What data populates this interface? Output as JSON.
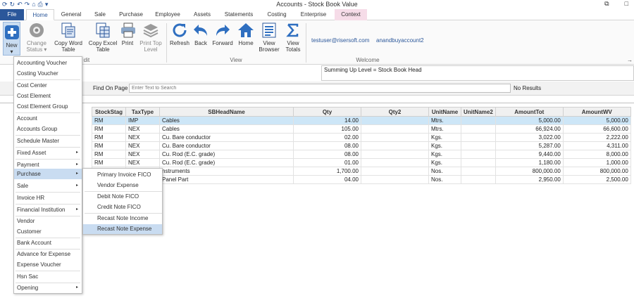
{
  "window": {
    "title": "Accounts - Stock Book Value"
  },
  "quick_access": [
    "qat-refresh-icon",
    "qat-sync-icon",
    "qat-undo-icon",
    "qat-redo-icon",
    "qat-home-icon",
    "qat-print-icon",
    "qat-dropdown-icon"
  ],
  "tabs": [
    {
      "label": "File"
    },
    {
      "label": "Home"
    },
    {
      "label": "General"
    },
    {
      "label": "Sale"
    },
    {
      "label": "Purchase"
    },
    {
      "label": "Employee"
    },
    {
      "label": "Assets"
    },
    {
      "label": "Statements"
    },
    {
      "label": "Costing"
    },
    {
      "label": "Enterprise"
    },
    {
      "label": "Context"
    }
  ],
  "ribbon": {
    "new": {
      "label": "New",
      "caret": "▾"
    },
    "change_status": {
      "line1": "Change",
      "line2": "Status ▾"
    },
    "copy_word": {
      "line1": "Copy Word",
      "line2": "Table"
    },
    "copy_excel": {
      "line1": "Copy Excel",
      "line2": "Table"
    },
    "print": {
      "label": "Print"
    },
    "print_top": {
      "line1": "Print Top",
      "line2": "Level"
    },
    "refresh": {
      "label": "Refresh"
    },
    "back": {
      "label": "Back"
    },
    "forward": {
      "label": "Forward"
    },
    "home": {
      "label": "Home"
    },
    "view_browser": {
      "line1": "View",
      "line2": "Browser"
    },
    "view_totals": {
      "line1": "View",
      "line2": "Totals"
    },
    "edit_group_fragment": "dit",
    "view_group": "View",
    "welcome_group": "Welcome",
    "user_email": "testuser@risersoft.com",
    "account_name": "anandbuyaccount2",
    "pin": "→"
  },
  "summary": {
    "text": "Summing Up Level = Stock Book Head"
  },
  "find": {
    "label": "Find On Page",
    "placeholder": "Enter Text to Search",
    "result": "No Results"
  },
  "grid": {
    "columns": [
      "StockStag",
      "TaxType",
      "SBHeadName",
      "Qty",
      "Qty2",
      "UnitName",
      "UnitName2",
      "AmountTot",
      "AmountWV"
    ],
    "rows": [
      [
        "RM",
        "IMP",
        "Cables",
        "14.00",
        "",
        "Mtrs.",
        "",
        "5,000.00",
        "5,000.00"
      ],
      [
        "RM",
        "NEX",
        "Cables",
        "105.00",
        "",
        "Mtrs.",
        "",
        "66,924.00",
        "66,600.00"
      ],
      [
        "RM",
        "NEX",
        "Cu. Bare conductor",
        "02.00",
        "",
        "Kgs.",
        "",
        "3,022.00",
        "2,222.00"
      ],
      [
        "RM",
        "NEX",
        "Cu. Bare conductor",
        "08.00",
        "",
        "Kgs.",
        "",
        "5,287.00",
        "4,311.00"
      ],
      [
        "RM",
        "NEX",
        "Cu. Rod (E.C. grade)",
        "08.00",
        "",
        "Kgs.",
        "",
        "9,440.00",
        "8,000.00"
      ],
      [
        "RM",
        "NEX",
        "Cu. Rod (E.C. grade)",
        "01.00",
        "",
        "Kgs.",
        "",
        "1,180.00",
        "1,000.00"
      ],
      [
        "",
        "",
        "nstruments",
        "1,700.00",
        "",
        "Nos.",
        "",
        "800,000.00",
        "800,000.00"
      ],
      [
        "",
        "",
        "Panel Part",
        "04.00",
        "",
        "Nos.",
        "",
        "2,950.00",
        "2,500.00"
      ]
    ]
  },
  "menu": {
    "items": [
      {
        "label": "Accounting Voucher",
        "arrow": ""
      },
      {
        "label": "Costing Voucher",
        "arrow": ""
      },
      {
        "label": "Cost Center",
        "arrow": ""
      },
      {
        "label": "Cost Element",
        "arrow": ""
      },
      {
        "label": "Cost Element Group",
        "arrow": ""
      },
      {
        "label": "Account",
        "arrow": ""
      },
      {
        "label": "Accounts Group",
        "arrow": ""
      },
      {
        "label": "Schedule Master",
        "arrow": ""
      },
      {
        "label": "Fixed Asset",
        "arrow": "▸"
      },
      {
        "label": "Payment",
        "arrow": "▸"
      },
      {
        "label": "Purchase",
        "arrow": "▸"
      },
      {
        "label": "Sale",
        "arrow": "▸"
      },
      {
        "label": "Invoice HR",
        "arrow": ""
      },
      {
        "label": "Financial Institution",
        "arrow": "▸"
      },
      {
        "label": "Vendor",
        "arrow": ""
      },
      {
        "label": "Customer",
        "arrow": ""
      },
      {
        "label": "Bank Account",
        "arrow": ""
      },
      {
        "label": "Advance for Expense",
        "arrow": ""
      },
      {
        "label": "Expense Voucher",
        "arrow": ""
      },
      {
        "label": "Hsn Sac",
        "arrow": ""
      },
      {
        "label": "Opening",
        "arrow": "▸"
      }
    ],
    "submenu": [
      {
        "label": "Primary Invoice FICO"
      },
      {
        "label": "Vendor Expense"
      },
      {
        "label": "Debit Note FICO"
      },
      {
        "label": "Credit Note FICO"
      },
      {
        "label": "Recast Note Income"
      },
      {
        "label": "Recast Note Expense"
      }
    ]
  },
  "colors": {
    "accent": "#2b579a",
    "selection": "#cde6f7",
    "menu_highlight": "#c9dcf1",
    "context_tab": "#f6dce8"
  }
}
